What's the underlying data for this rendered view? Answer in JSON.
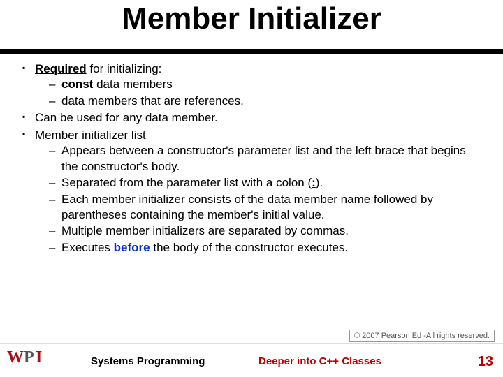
{
  "title": "Member Initializer",
  "bullets": {
    "b1_lead": "Required",
    "b1_tail": " for initializing:",
    "b1_s1_lead": "const",
    "b1_s1_tail": " data members",
    "b1_s2": "data members that are references.",
    "b2": "Can be used for any data member.",
    "b3": "Member initializer list",
    "b3_s1": "Appears between a constructor's parameter list and the left brace that begins the constructor's body.",
    "b3_s2_a": "Separated from the parameter list with a colon (",
    "b3_s2_colon": ":",
    "b3_s2_b": ").",
    "b3_s3": "Each member initializer consists of the data member name followed by parentheses containing the member's initial value.",
    "b3_s4": "Multiple member initializers are separated by commas.",
    "b3_s5_a": "Executes ",
    "b3_s5_kw": "before",
    "b3_s5_b": " the body of the constructor executes."
  },
  "copyright": "© 2007 Pearson Ed -All rights reserved.",
  "footer": {
    "center": "Systems Programming",
    "right": "Deeper into C++ Classes",
    "page": "13"
  },
  "logo_text": "WPI"
}
